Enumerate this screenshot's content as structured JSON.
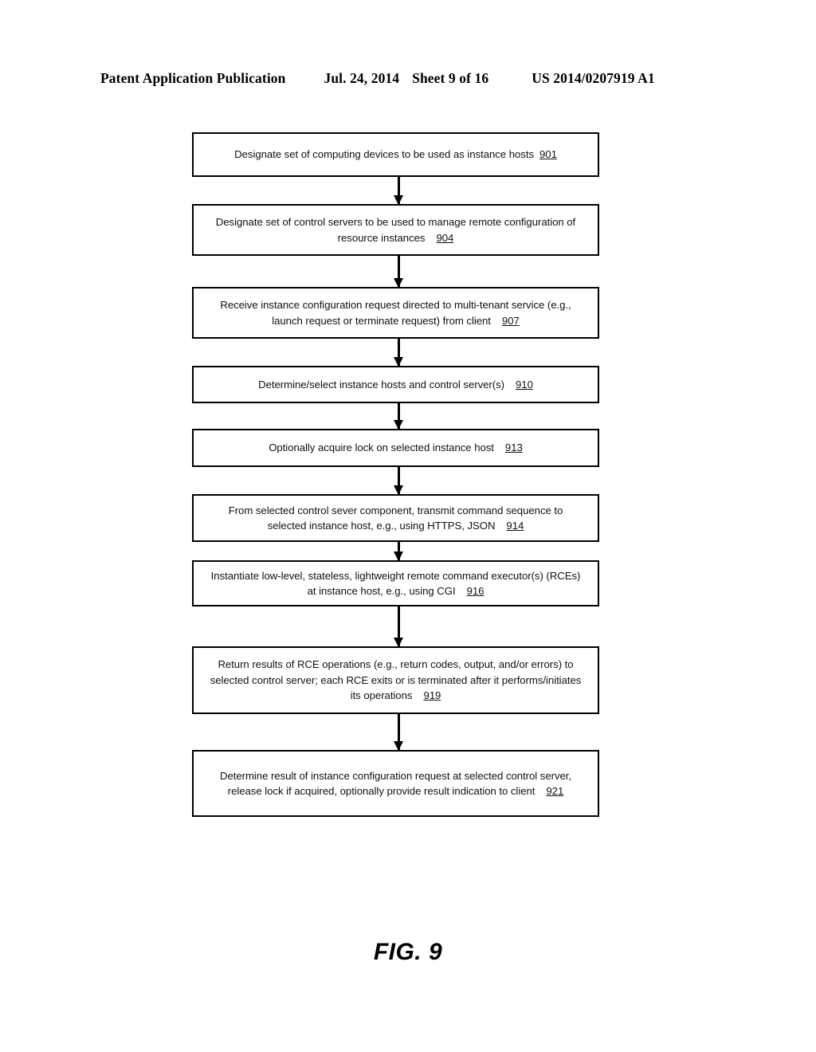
{
  "header": {
    "publication": "Patent Application Publication",
    "date": "Jul. 24, 2014",
    "sheet": "Sheet 9 of 16",
    "patent_number": "US 2014/0207919 A1"
  },
  "figure": {
    "caption": "FIG. 9"
  },
  "flowchart": {
    "type": "flowchart",
    "orientation": "vertical",
    "nodes": [
      {
        "id": "901",
        "ref": "901",
        "text": "Designate set of computing devices to be used as instance hosts",
        "lines": [
          "Designate set of computing devices to be used as instance hosts"
        ]
      },
      {
        "id": "904",
        "ref": "904",
        "text": "Designate set of control servers to be used to manage remote configuration of resource instances",
        "lines": [
          "Designate set of control servers to be used to manage remote configuration of",
          "resource instances"
        ]
      },
      {
        "id": "907",
        "ref": "907",
        "text": "Receive instance configuration request directed to multi-tenant service (e.g., launch request or terminate request) from client",
        "lines": [
          "Receive instance configuration request directed to multi-tenant service (e.g.,",
          "launch request or terminate request) from client"
        ]
      },
      {
        "id": "910",
        "ref": "910",
        "text": "Determine/select instance hosts and control server(s)",
        "lines": [
          "Determine/select instance hosts and control server(s)"
        ]
      },
      {
        "id": "913",
        "ref": "913",
        "text": "Optionally acquire lock on selected instance host",
        "lines": [
          "Optionally acquire lock on selected instance host"
        ]
      },
      {
        "id": "914",
        "ref": "914",
        "text": "From selected control sever component, transmit command sequence to selected instance host, e.g., using HTTPS, JSON",
        "lines": [
          "From selected control sever component, transmit command sequence to",
          "selected instance host, e.g., using HTTPS, JSON"
        ]
      },
      {
        "id": "916",
        "ref": "916",
        "text": "Instantiate low-level, stateless, lightweight remote command executor(s) (RCEs) at instance host, e.g., using CGI",
        "lines": [
          "Instantiate low-level, stateless, lightweight remote command executor(s) (RCEs)",
          "at instance host, e.g., using CGI"
        ]
      },
      {
        "id": "919",
        "ref": "919",
        "text": "Return results of RCE operations (e.g., return codes, output, and/or errors) to selected control server; each RCE exits or is terminated after it performs/initiates its operations",
        "lines": [
          "Return results of RCE operations (e.g., return codes, output, and/or errors) to",
          "selected control server; each RCE exits or is terminated after it performs/initiates",
          "its operations"
        ]
      },
      {
        "id": "921",
        "ref": "921",
        "text": "Determine result of instance configuration request at selected control server, release lock if acquired, optionally provide result indication to client",
        "lines": [
          "Determine result of instance configuration request at selected control server,",
          "release lock if acquired, optionally provide result indication to client"
        ]
      }
    ],
    "edges": [
      {
        "from": "901",
        "to": "904"
      },
      {
        "from": "904",
        "to": "907"
      },
      {
        "from": "907",
        "to": "910"
      },
      {
        "from": "910",
        "to": "913"
      },
      {
        "from": "913",
        "to": "914"
      },
      {
        "from": "914",
        "to": "916"
      },
      {
        "from": "916",
        "to": "919"
      },
      {
        "from": "919",
        "to": "921"
      }
    ]
  }
}
